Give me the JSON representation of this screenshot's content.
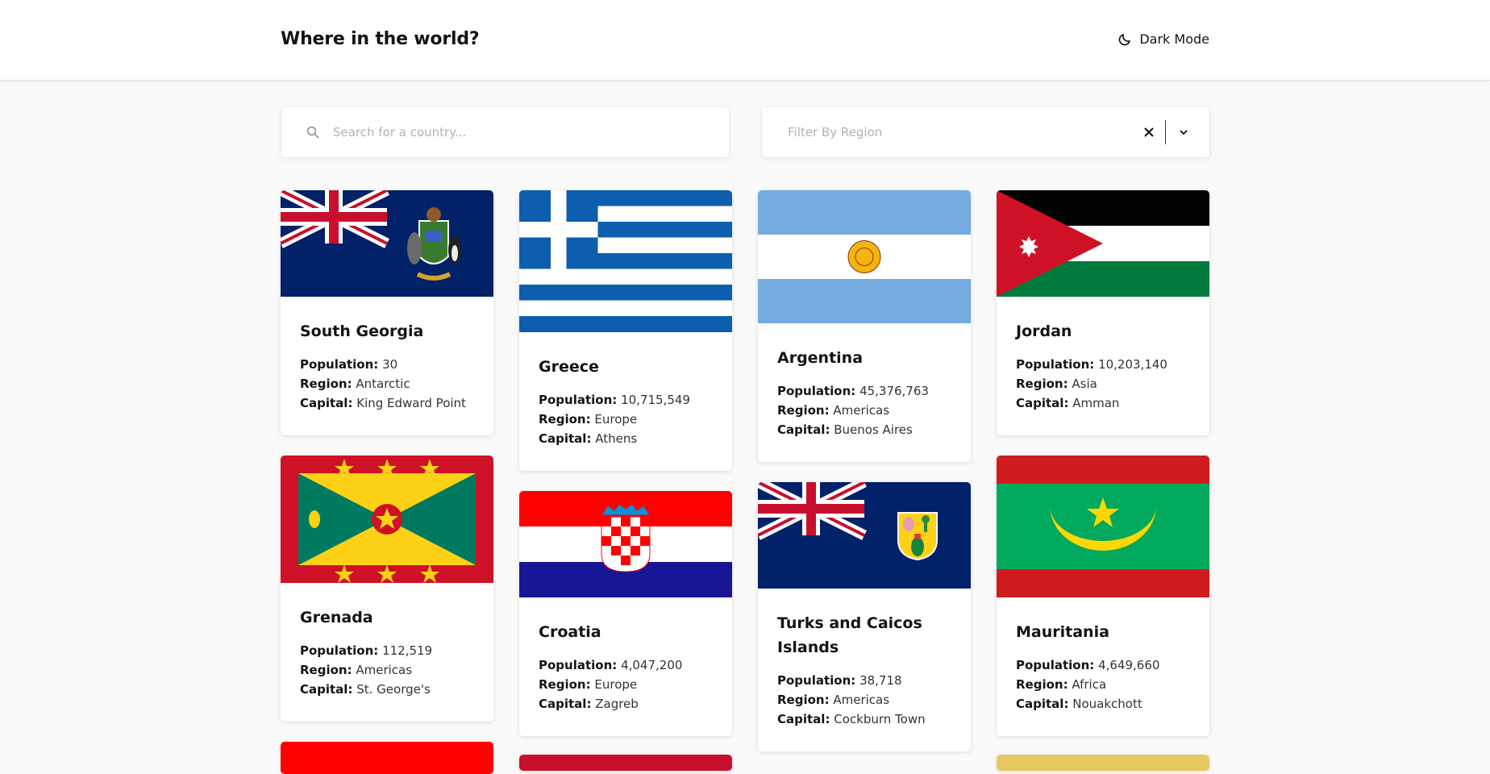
{
  "header": {
    "title": "Where in the world?",
    "mode_label": "Dark Mode"
  },
  "search": {
    "placeholder": "Search for a country..."
  },
  "filter": {
    "placeholder": "Filter By Region"
  },
  "labels": {
    "population": "Population:",
    "region": "Region:",
    "capital": "Capital:"
  },
  "countries": [
    {
      "name": "South Georgia",
      "population": "30",
      "region": "Antarctic",
      "capital": "King Edward Point"
    },
    {
      "name": "Greece",
      "population": "10,715,549",
      "region": "Europe",
      "capital": "Athens"
    },
    {
      "name": "Argentina",
      "population": "45,376,763",
      "region": "Americas",
      "capital": "Buenos Aires"
    },
    {
      "name": "Jordan",
      "population": "10,203,140",
      "region": "Asia",
      "capital": "Amman"
    },
    {
      "name": "Grenada",
      "population": "112,519",
      "region": "Americas",
      "capital": "St. George's"
    },
    {
      "name": "Croatia",
      "population": "4,047,200",
      "region": "Europe",
      "capital": "Zagreb"
    },
    {
      "name": "Turks and Caicos Islands",
      "population": "38,718",
      "region": "Americas",
      "capital": "Cockburn Town"
    },
    {
      "name": "Mauritania",
      "population": "4,649,660",
      "region": "Africa",
      "capital": "Nouakchott"
    }
  ]
}
